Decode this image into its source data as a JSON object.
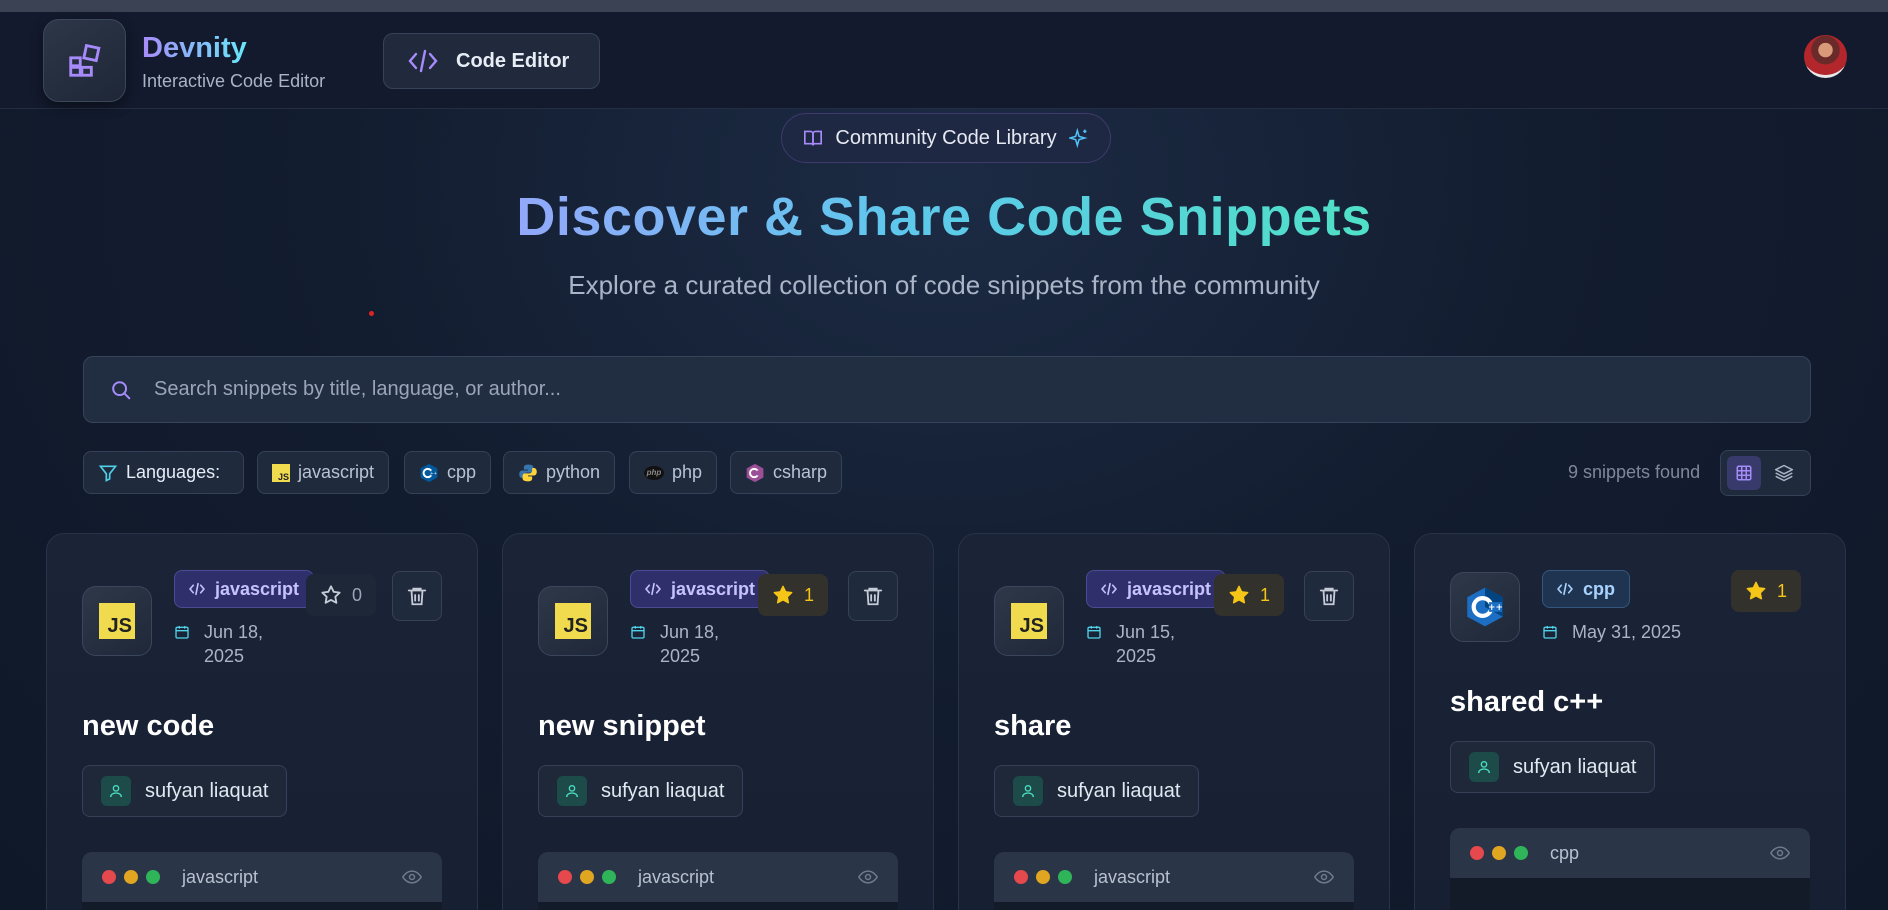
{
  "header": {
    "brand": "Devnity",
    "subtitle": "Interactive Code Editor",
    "editor_button": "Code Editor"
  },
  "hero": {
    "pill": "Community Code Library",
    "title": "Discover & Share Code Snippets",
    "subtitle": "Explore a curated collection of code snippets from the community"
  },
  "search": {
    "placeholder": "Search snippets by title, language, or author..."
  },
  "filters": {
    "label": "Languages:",
    "chips": [
      "javascript",
      "cpp",
      "python",
      "php",
      "csharp"
    ],
    "php_logo": "php"
  },
  "results": {
    "count_text": "9 snippets found"
  },
  "cards": [
    {
      "language": "javascript",
      "date_line1": "Jun 18,",
      "date_line2": "2025",
      "stars": "0",
      "title": "new code",
      "author": "sufyan liaquat",
      "code_lang": "javascript"
    },
    {
      "language": "javascript",
      "date_line1": "Jun 18,",
      "date_line2": "2025",
      "stars": "1",
      "title": "new snippet",
      "author": "sufyan liaquat",
      "code_lang": "javascript"
    },
    {
      "language": "javascript",
      "date_line1": "Jun 15,",
      "date_line2": "2025",
      "stars": "1",
      "title": "share",
      "author": "sufyan liaquat",
      "code_lang": "javascript"
    },
    {
      "language": "cpp",
      "date_line1": "May 31, 2025",
      "stars": "1",
      "title": "shared c++",
      "author": "sufyan liaquat",
      "code_lang": "cpp"
    }
  ],
  "logos": {
    "js": "JS"
  },
  "icons": {
    "logo": "grid-squares-icon",
    "editor": "code-brackets-icon",
    "book": "book-open-icon",
    "sparkle": "sparkles-icon",
    "search": "search-icon",
    "filter": "filter-icon",
    "grid": "grid-icon",
    "layers": "layers-icon",
    "star": "star-icon",
    "trash": "trash-icon",
    "calendar": "calendar-icon",
    "user": "user-icon",
    "eye": "eye-icon"
  },
  "colors": {
    "accent_purple": "#a78bfa",
    "accent_cyan": "#4fe0c6",
    "star_gold": "#f5c518",
    "traffic_red": "#e5484d",
    "traffic_yellow": "#e0a521",
    "traffic_green": "#30b45a"
  }
}
